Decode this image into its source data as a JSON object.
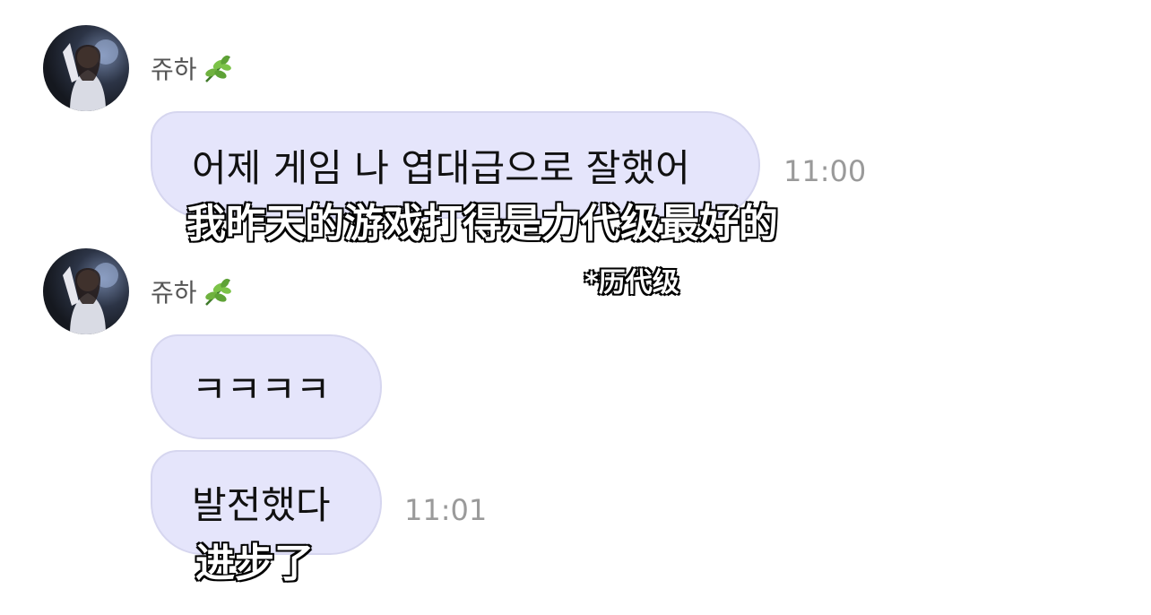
{
  "chat": {
    "messages": [
      {
        "sender": "쥬하",
        "sender_icon": "herb-leaf-emoji-icon",
        "lines": [
          {
            "text": "어제 게임 나 엽대급으로 잘했어",
            "time": "11:00"
          }
        ]
      },
      {
        "sender": "쥬하",
        "sender_icon": "herb-leaf-emoji-icon",
        "lines": [
          {
            "text": "ㅋㅋㅋㅋ",
            "time": ""
          },
          {
            "text": "발전했다",
            "time": "11:01"
          }
        ]
      }
    ]
  },
  "subtitles": {
    "line1": "我昨天的游戏打得是力代级最好的",
    "note": "*历代级",
    "line2": "进步了"
  },
  "colors": {
    "bubble": "#e5e5fb",
    "time": "#9a9a9a",
    "sender": "#555555"
  }
}
